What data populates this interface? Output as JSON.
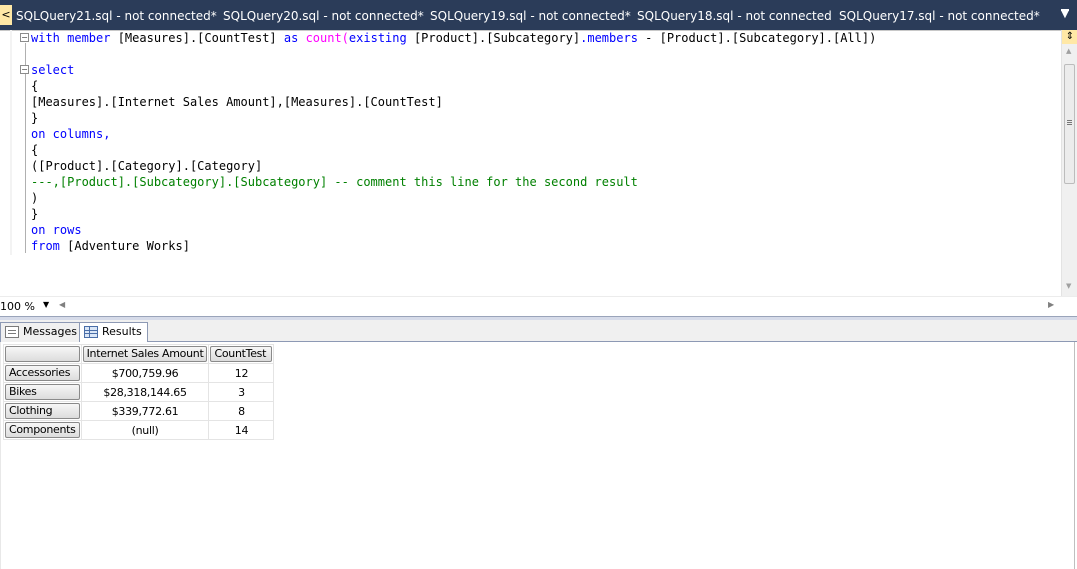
{
  "tabs": [
    {
      "label": "SQLQuery21.sql - not connected*"
    },
    {
      "label": "SQLQuery20.sql - not connected*"
    },
    {
      "label": "SQLQuery19.sql - not connected*"
    },
    {
      "label": "SQLQuery18.sql - not connected"
    },
    {
      "label": "SQLQuery17.sql - not connected*"
    }
  ],
  "editor": {
    "lines": [
      [
        {
          "t": "with member ",
          "c": "kw"
        },
        {
          "t": "[Measures].[CountTest] ",
          "c": "tx"
        },
        {
          "t": "as ",
          "c": "kw"
        },
        {
          "t": "count(",
          "c": "fn"
        },
        {
          "t": "existing ",
          "c": "kw"
        },
        {
          "t": "[Product].[Subcategory]",
          "c": "tx"
        },
        {
          "t": ".members",
          "c": "kw"
        },
        {
          "t": " - [Product].[Subcategory].[All])",
          "c": "tx"
        }
      ],
      [],
      [
        {
          "t": "select",
          "c": "kw"
        }
      ],
      [
        {
          "t": "{",
          "c": "tx"
        }
      ],
      [
        {
          "t": "[Measures].[Internet Sales Amount],[Measures].[CountTest]",
          "c": "tx"
        }
      ],
      [
        {
          "t": "}",
          "c": "tx"
        }
      ],
      [
        {
          "t": "on columns,",
          "c": "kw"
        }
      ],
      [
        {
          "t": "{",
          "c": "tx"
        }
      ],
      [
        {
          "t": "([Product].[Category].[Category]",
          "c": "tx"
        }
      ],
      [
        {
          "t": "---,[Product].[Subcategory].[Subcategory] -- comment this line for the second result",
          "c": "cm"
        }
      ],
      [
        {
          "t": ")",
          "c": "tx"
        }
      ],
      [
        {
          "t": "}",
          "c": "tx"
        }
      ],
      [
        {
          "t": "on rows",
          "c": "kw"
        }
      ],
      [
        {
          "t": "from ",
          "c": "kw"
        },
        {
          "t": "[Adventure Works]",
          "c": "tx"
        }
      ]
    ],
    "zoom": "100 %"
  },
  "results": {
    "tabs": {
      "messages": "Messages",
      "results": "Results"
    },
    "columns": [
      "",
      "Internet Sales Amount",
      "CountTest"
    ],
    "rows": [
      {
        "label": "Accessories",
        "amount": "$700,759.96",
        "count": "12"
      },
      {
        "label": "Bikes",
        "amount": "$28,318,144.65",
        "count": "3"
      },
      {
        "label": "Clothing",
        "amount": "$339,772.61",
        "count": "8"
      },
      {
        "label": "Components",
        "amount": "(null)",
        "count": "14"
      }
    ]
  }
}
